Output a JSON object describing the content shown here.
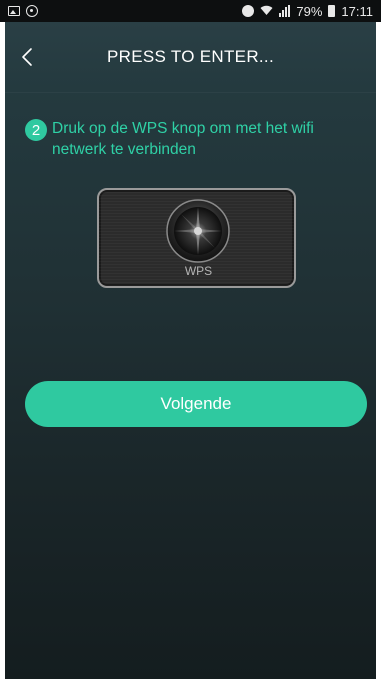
{
  "status_bar": {
    "left_icons": [
      "image-icon",
      "circle-icon"
    ],
    "right_icons": [
      "alarm-icon",
      "wifi-icon",
      "signal-icon",
      "battery-icon"
    ],
    "battery": "79%",
    "time": "17:11"
  },
  "header": {
    "back_icon": "chevron-left-icon",
    "title": "PRESS TO ENTER..."
  },
  "step": {
    "number": "2",
    "text": "Druk op de WPS knop om met het wifi netwerk te verbinden"
  },
  "wps_device": {
    "label": "WPS"
  },
  "next_button": {
    "label": "Volgende"
  },
  "colors": {
    "accent": "#2fc9a0",
    "accent_text": "#2fd1a6",
    "background_top": "#2a3f45",
    "background_bottom": "#141d1f"
  }
}
